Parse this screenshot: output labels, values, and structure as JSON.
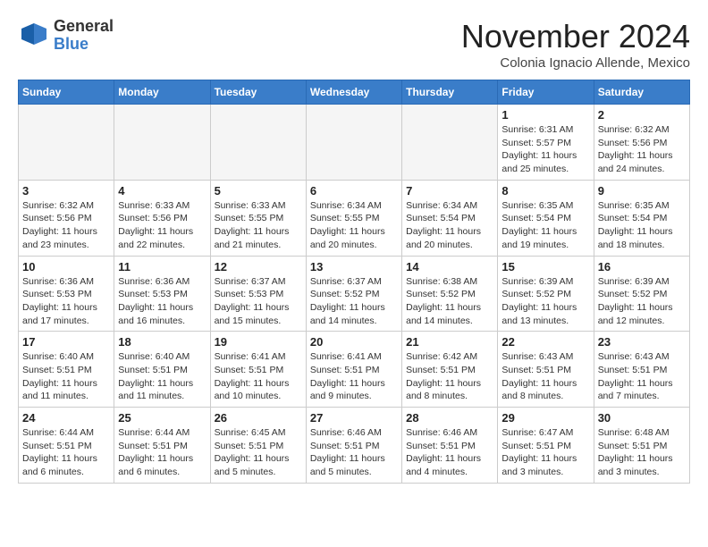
{
  "header": {
    "logo_line1": "General",
    "logo_line2": "Blue",
    "month": "November 2024",
    "location": "Colonia Ignacio Allende, Mexico"
  },
  "weekdays": [
    "Sunday",
    "Monday",
    "Tuesday",
    "Wednesday",
    "Thursday",
    "Friday",
    "Saturday"
  ],
  "weeks": [
    [
      {
        "day": "",
        "info": ""
      },
      {
        "day": "",
        "info": ""
      },
      {
        "day": "",
        "info": ""
      },
      {
        "day": "",
        "info": ""
      },
      {
        "day": "",
        "info": ""
      },
      {
        "day": "1",
        "info": "Sunrise: 6:31 AM\nSunset: 5:57 PM\nDaylight: 11 hours\nand 25 minutes."
      },
      {
        "day": "2",
        "info": "Sunrise: 6:32 AM\nSunset: 5:56 PM\nDaylight: 11 hours\nand 24 minutes."
      }
    ],
    [
      {
        "day": "3",
        "info": "Sunrise: 6:32 AM\nSunset: 5:56 PM\nDaylight: 11 hours\nand 23 minutes."
      },
      {
        "day": "4",
        "info": "Sunrise: 6:33 AM\nSunset: 5:56 PM\nDaylight: 11 hours\nand 22 minutes."
      },
      {
        "day": "5",
        "info": "Sunrise: 6:33 AM\nSunset: 5:55 PM\nDaylight: 11 hours\nand 21 minutes."
      },
      {
        "day": "6",
        "info": "Sunrise: 6:34 AM\nSunset: 5:55 PM\nDaylight: 11 hours\nand 20 minutes."
      },
      {
        "day": "7",
        "info": "Sunrise: 6:34 AM\nSunset: 5:54 PM\nDaylight: 11 hours\nand 20 minutes."
      },
      {
        "day": "8",
        "info": "Sunrise: 6:35 AM\nSunset: 5:54 PM\nDaylight: 11 hours\nand 19 minutes."
      },
      {
        "day": "9",
        "info": "Sunrise: 6:35 AM\nSunset: 5:54 PM\nDaylight: 11 hours\nand 18 minutes."
      }
    ],
    [
      {
        "day": "10",
        "info": "Sunrise: 6:36 AM\nSunset: 5:53 PM\nDaylight: 11 hours\nand 17 minutes."
      },
      {
        "day": "11",
        "info": "Sunrise: 6:36 AM\nSunset: 5:53 PM\nDaylight: 11 hours\nand 16 minutes."
      },
      {
        "day": "12",
        "info": "Sunrise: 6:37 AM\nSunset: 5:53 PM\nDaylight: 11 hours\nand 15 minutes."
      },
      {
        "day": "13",
        "info": "Sunrise: 6:37 AM\nSunset: 5:52 PM\nDaylight: 11 hours\nand 14 minutes."
      },
      {
        "day": "14",
        "info": "Sunrise: 6:38 AM\nSunset: 5:52 PM\nDaylight: 11 hours\nand 14 minutes."
      },
      {
        "day": "15",
        "info": "Sunrise: 6:39 AM\nSunset: 5:52 PM\nDaylight: 11 hours\nand 13 minutes."
      },
      {
        "day": "16",
        "info": "Sunrise: 6:39 AM\nSunset: 5:52 PM\nDaylight: 11 hours\nand 12 minutes."
      }
    ],
    [
      {
        "day": "17",
        "info": "Sunrise: 6:40 AM\nSunset: 5:51 PM\nDaylight: 11 hours\nand 11 minutes."
      },
      {
        "day": "18",
        "info": "Sunrise: 6:40 AM\nSunset: 5:51 PM\nDaylight: 11 hours\nand 11 minutes."
      },
      {
        "day": "19",
        "info": "Sunrise: 6:41 AM\nSunset: 5:51 PM\nDaylight: 11 hours\nand 10 minutes."
      },
      {
        "day": "20",
        "info": "Sunrise: 6:41 AM\nSunset: 5:51 PM\nDaylight: 11 hours\nand 9 minutes."
      },
      {
        "day": "21",
        "info": "Sunrise: 6:42 AM\nSunset: 5:51 PM\nDaylight: 11 hours\nand 8 minutes."
      },
      {
        "day": "22",
        "info": "Sunrise: 6:43 AM\nSunset: 5:51 PM\nDaylight: 11 hours\nand 8 minutes."
      },
      {
        "day": "23",
        "info": "Sunrise: 6:43 AM\nSunset: 5:51 PM\nDaylight: 11 hours\nand 7 minutes."
      }
    ],
    [
      {
        "day": "24",
        "info": "Sunrise: 6:44 AM\nSunset: 5:51 PM\nDaylight: 11 hours\nand 6 minutes."
      },
      {
        "day": "25",
        "info": "Sunrise: 6:44 AM\nSunset: 5:51 PM\nDaylight: 11 hours\nand 6 minutes."
      },
      {
        "day": "26",
        "info": "Sunrise: 6:45 AM\nSunset: 5:51 PM\nDaylight: 11 hours\nand 5 minutes."
      },
      {
        "day": "27",
        "info": "Sunrise: 6:46 AM\nSunset: 5:51 PM\nDaylight: 11 hours\nand 5 minutes."
      },
      {
        "day": "28",
        "info": "Sunrise: 6:46 AM\nSunset: 5:51 PM\nDaylight: 11 hours\nand 4 minutes."
      },
      {
        "day": "29",
        "info": "Sunrise: 6:47 AM\nSunset: 5:51 PM\nDaylight: 11 hours\nand 3 minutes."
      },
      {
        "day": "30",
        "info": "Sunrise: 6:48 AM\nSunset: 5:51 PM\nDaylight: 11 hours\nand 3 minutes."
      }
    ]
  ]
}
